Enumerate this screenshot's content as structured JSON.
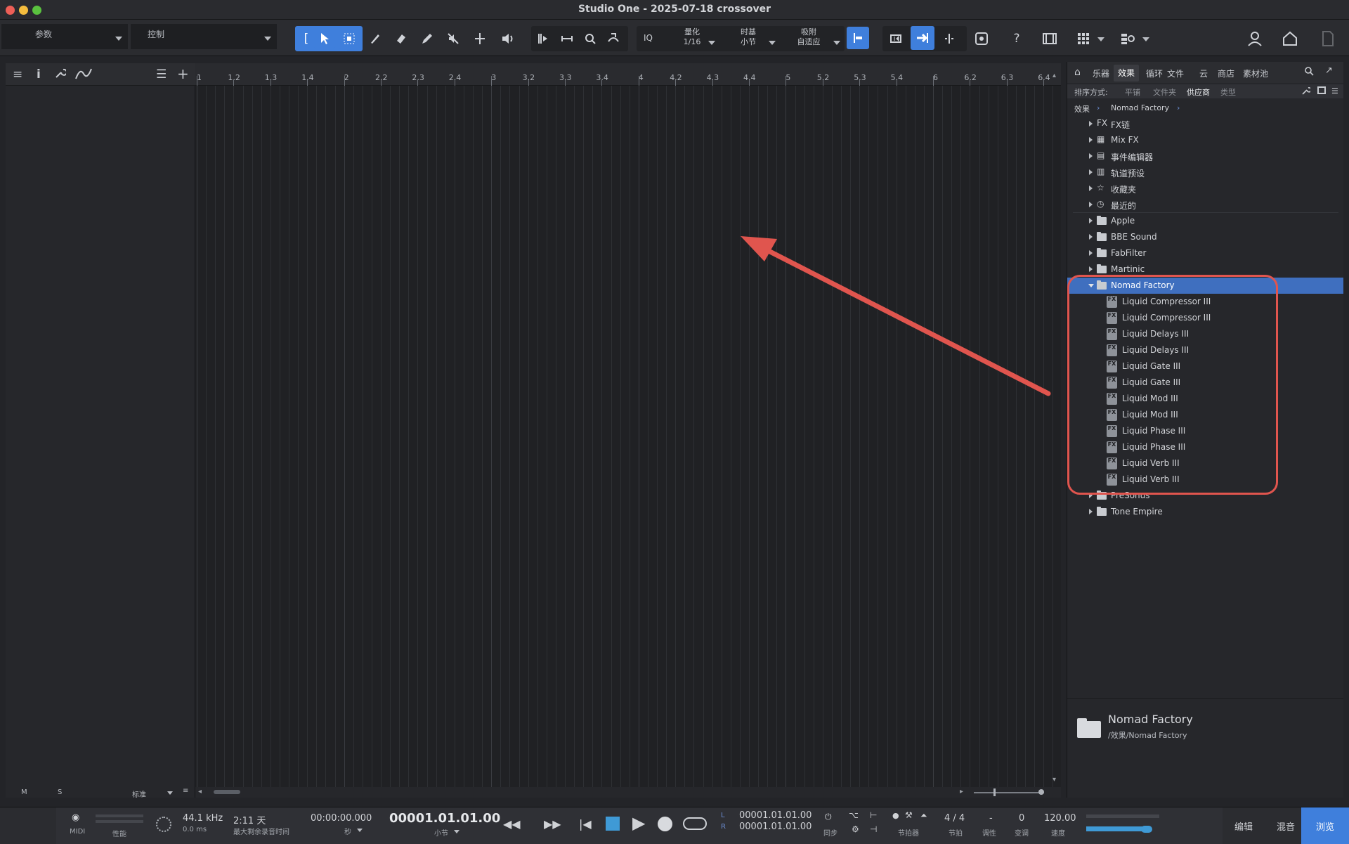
{
  "window": {
    "title": "Studio One - 2025-07-18 crossover"
  },
  "toolbar": {
    "params_label": "参数",
    "control_label": "控制",
    "iq_label": "IQ",
    "quantize_label": "量化",
    "quantize_value": "1/16",
    "timebase_label": "时基",
    "timebase_value": "小节",
    "snap_label": "吸附",
    "snap_value": "自适应",
    "help_label": "?"
  },
  "inspector": {
    "footer": {
      "m": "M",
      "s": "S",
      "mode": "标准"
    }
  },
  "ruler": {
    "ticks": [
      "1",
      "1.2",
      "1.3",
      "1.4",
      "2",
      "2.2",
      "2.3",
      "2.4",
      "3",
      "3.2",
      "3.3",
      "3.4",
      "4",
      "4.2",
      "4.3",
      "4.4",
      "5",
      "5.2",
      "5.3",
      "5.4",
      "6",
      "6.2",
      "6.3",
      "6.4"
    ]
  },
  "browser": {
    "tabs": [
      "乐器",
      "效果",
      "循环",
      "文件",
      "云",
      "商店",
      "素材池"
    ],
    "active_tab": "效果",
    "sort": {
      "label": "排序方式:",
      "options": [
        "平铺",
        "文件夹",
        "供应商",
        "类型"
      ],
      "active": "供应商"
    },
    "breadcrumb": [
      "效果",
      "Nomad Factory"
    ],
    "top_items": [
      {
        "label": "FX链",
        "icon": "fx-chain-icon"
      },
      {
        "label": "Mix FX",
        "icon": "mix-fx-icon"
      },
      {
        "label": "事件编辑器",
        "icon": "event-editor-icon"
      },
      {
        "label": "轨道预设",
        "icon": "track-preset-icon"
      },
      {
        "label": "收藏夹",
        "icon": "star-icon"
      },
      {
        "label": "最近的",
        "icon": "clock-icon"
      }
    ],
    "vendors_before": [
      "Apple",
      "BBE Sound",
      "FabFilter",
      "Martinic"
    ],
    "expanded_vendor": "Nomad Factory",
    "plugins": [
      "Liquid Compressor III",
      "Liquid Compressor III",
      "Liquid Delays III",
      "Liquid Delays III",
      "Liquid Gate III",
      "Liquid Gate III",
      "Liquid Mod III",
      "Liquid Mod III",
      "Liquid Phase III",
      "Liquid Phase III",
      "Liquid Verb III",
      "Liquid Verb III"
    ],
    "vendors_after": [
      "PreSonus",
      "Tone Empire"
    ],
    "info": {
      "name": "Nomad Factory",
      "path": "/效果/Nomad Factory"
    }
  },
  "transport": {
    "midi": "MIDI",
    "performance": "性能",
    "sample_rate": "44.1 kHz",
    "latency": "0.0 ms",
    "record_time": "2:11 天",
    "record_time_label": "最大剩余录音时间",
    "time_seconds": "00:00:00.000",
    "seconds_label": "秒",
    "position": "00001.01.01.00",
    "bars_label": "小节",
    "loop_l": "00001.01.01.00",
    "loop_r": "00001.01.01.00",
    "l_label": "L",
    "r_label": "R",
    "sync_label": "同步",
    "metronome_label": "节拍器",
    "time_sig": "4 / 4",
    "time_sig_label": "节拍",
    "key": "-",
    "key_label": "调性",
    "transpose": "0",
    "transpose_label": "变调",
    "tempo": "120.00",
    "tempo_label": "速度",
    "views": [
      "编辑",
      "混音",
      "浏览"
    ],
    "active_view": "浏览"
  },
  "colors": {
    "accent": "#3f7fdc",
    "selection": "#3f6fbf",
    "annotation": "#e0554e"
  }
}
